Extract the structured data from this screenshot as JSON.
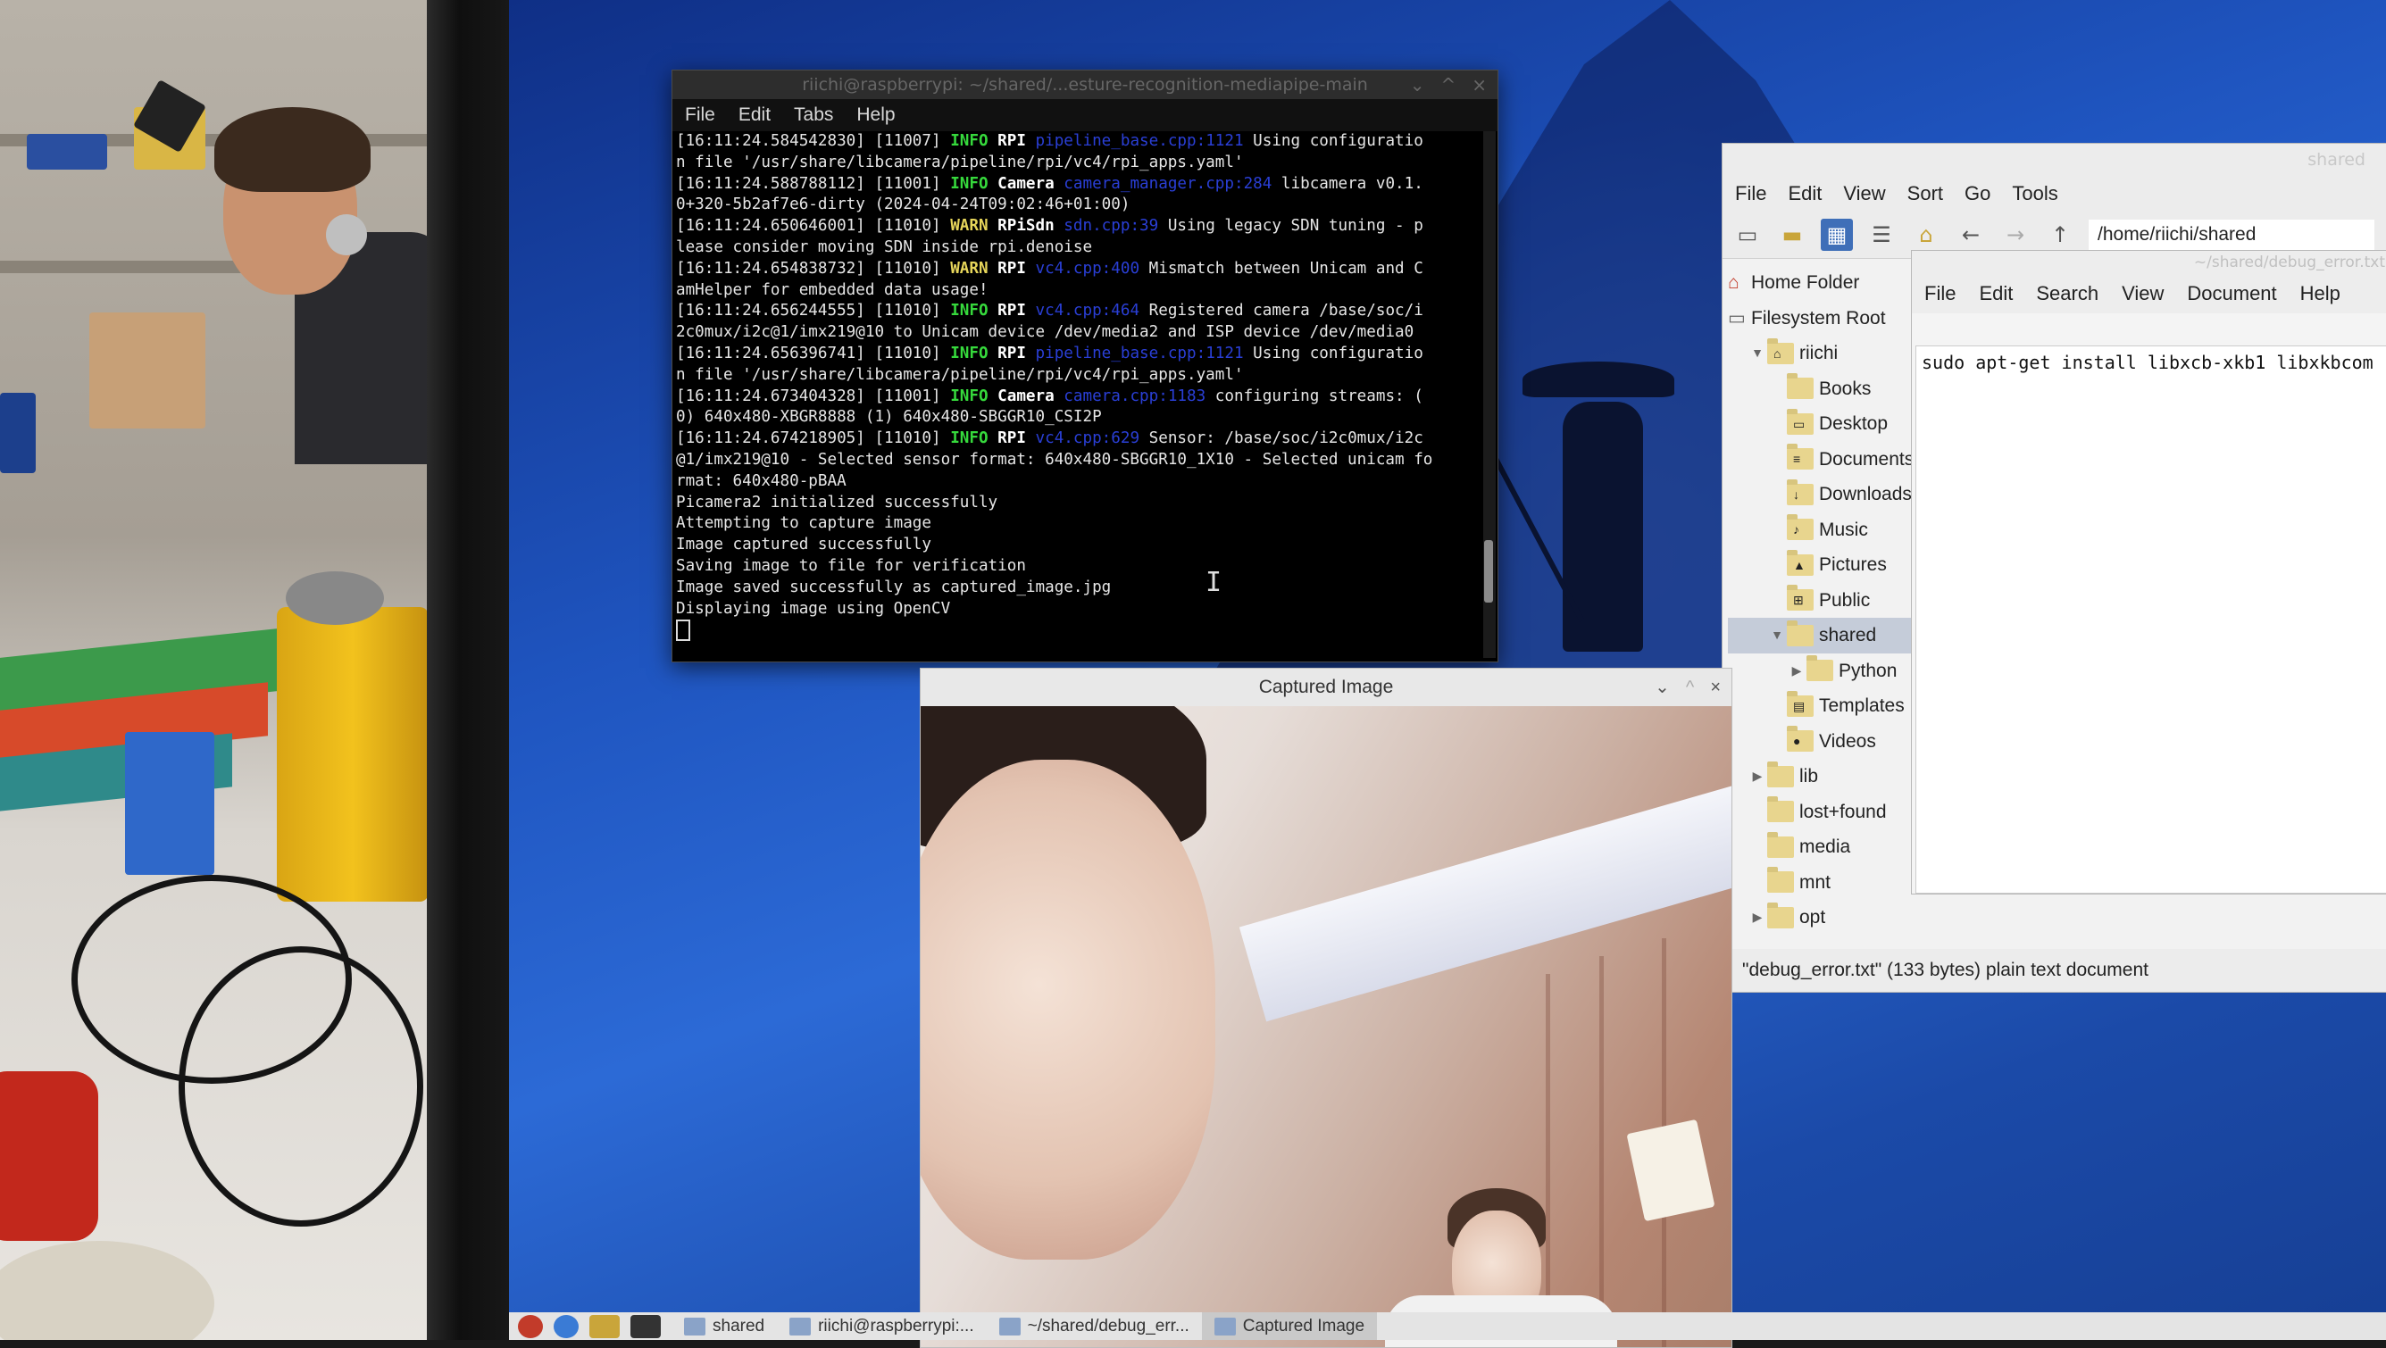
{
  "terminal": {
    "title": "riichi@raspberrypi: ~/shared/...esture-recognition-mediapipe-main",
    "menu": [
      "File",
      "Edit",
      "Tabs",
      "Help"
    ],
    "lines": [
      [
        {
          "t": "[16:11:24.584542830] [11007] "
        },
        {
          "t": "INFO",
          "c": "t-info"
        },
        {
          "t": " "
        },
        {
          "t": "RPI",
          "c": "t-cat"
        },
        {
          "t": " pipeline_base.cpp:1121",
          "c": "t-src"
        },
        {
          "t": " Using configuratio"
        }
      ],
      [
        {
          "t": "n file '/usr/share/libcamera/pipeline/rpi/vc4/rpi_apps.yaml'"
        }
      ],
      [
        {
          "t": "[16:11:24.588788112] [11001] "
        },
        {
          "t": "INFO",
          "c": "t-info"
        },
        {
          "t": " "
        },
        {
          "t": "Camera",
          "c": "t-cat"
        },
        {
          "t": " camera_manager.cpp:284",
          "c": "t-src"
        },
        {
          "t": " libcamera v0.1."
        }
      ],
      [
        {
          "t": "0+320-5b2af7e6-dirty (2024-04-24T09:02:46+01:00)"
        }
      ],
      [
        {
          "t": "[16:11:24.650646001] [11010] "
        },
        {
          "t": "WARN",
          "c": "t-warn"
        },
        {
          "t": " "
        },
        {
          "t": "RPiSdn",
          "c": "t-cat"
        },
        {
          "t": " sdn.cpp:39",
          "c": "t-src"
        },
        {
          "t": " Using legacy SDN tuning - p"
        }
      ],
      [
        {
          "t": "lease consider moving SDN inside rpi.denoise"
        }
      ],
      [
        {
          "t": "[16:11:24.654838732] [11010] "
        },
        {
          "t": "WARN",
          "c": "t-warn"
        },
        {
          "t": " "
        },
        {
          "t": "RPI",
          "c": "t-cat"
        },
        {
          "t": " vc4.cpp:400",
          "c": "t-src"
        },
        {
          "t": " Mismatch between Unicam and C"
        }
      ],
      [
        {
          "t": "amHelper for embedded data usage!"
        }
      ],
      [
        {
          "t": "[16:11:24.656244555] [11010] "
        },
        {
          "t": "INFO",
          "c": "t-info"
        },
        {
          "t": " "
        },
        {
          "t": "RPI",
          "c": "t-cat"
        },
        {
          "t": " vc4.cpp:464",
          "c": "t-src"
        },
        {
          "t": " Registered camera /base/soc/i"
        }
      ],
      [
        {
          "t": "2c0mux/i2c@1/imx219@10 to Unicam device /dev/media2 and ISP device /dev/media0"
        }
      ],
      [
        {
          "t": "[16:11:24.656396741] [11010] "
        },
        {
          "t": "INFO",
          "c": "t-info"
        },
        {
          "t": " "
        },
        {
          "t": "RPI",
          "c": "t-cat"
        },
        {
          "t": " pipeline_base.cpp:1121",
          "c": "t-src"
        },
        {
          "t": " Using configuratio"
        }
      ],
      [
        {
          "t": "n file '/usr/share/libcamera/pipeline/rpi/vc4/rpi_apps.yaml'"
        }
      ],
      [
        {
          "t": "[16:11:24.673404328] [11001] "
        },
        {
          "t": "INFO",
          "c": "t-info"
        },
        {
          "t": " "
        },
        {
          "t": "Camera",
          "c": "t-cat"
        },
        {
          "t": " camera.cpp:1183",
          "c": "t-src"
        },
        {
          "t": " configuring streams: ("
        }
      ],
      [
        {
          "t": "0) 640x480-XBGR8888 (1) 640x480-SBGGR10_CSI2P"
        }
      ],
      [
        {
          "t": "[16:11:24.674218905] [11010] "
        },
        {
          "t": "INFO",
          "c": "t-info"
        },
        {
          "t": " "
        },
        {
          "t": "RPI",
          "c": "t-cat"
        },
        {
          "t": " vc4.cpp:629",
          "c": "t-src"
        },
        {
          "t": " Sensor: /base/soc/i2c0mux/i2c"
        }
      ],
      [
        {
          "t": "@1/imx219@10 - Selected sensor format: 640x480-SBGGR10_1X10 - Selected unicam fo"
        }
      ],
      [
        {
          "t": "rmat: 640x480-pBAA"
        }
      ],
      [
        {
          "t": "Picamera2 initialized successfully"
        }
      ],
      [
        {
          "t": "Attempting to capture image"
        }
      ],
      [
        {
          "t": "Image captured successfully"
        }
      ],
      [
        {
          "t": "Saving image to file for verification"
        }
      ],
      [
        {
          "t": "Image saved successfully as captured_image.jpg"
        }
      ],
      [
        {
          "t": "Displaying image using OpenCV"
        }
      ]
    ],
    "scroll_position": 0.88
  },
  "captured_window": {
    "title": "Captured Image"
  },
  "file_manager": {
    "title": "shared",
    "menu": [
      "File",
      "Edit",
      "View",
      "Sort",
      "Go",
      "Tools"
    ],
    "path": "/home/riichi/shared",
    "places": [
      {
        "label": "Home Folder",
        "icon": "home-icon"
      },
      {
        "label": "Filesystem Root",
        "icon": "drive-icon"
      }
    ],
    "tree": [
      {
        "label": "riichi",
        "indent": 1,
        "toggle": "▼",
        "glyph": "⌂"
      },
      {
        "label": "Books",
        "indent": 2,
        "toggle": "",
        "glyph": ""
      },
      {
        "label": "Desktop",
        "indent": 2,
        "toggle": "",
        "glyph": "▭"
      },
      {
        "label": "Documents",
        "indent": 2,
        "toggle": "",
        "glyph": "≡"
      },
      {
        "label": "Downloads",
        "indent": 2,
        "toggle": "",
        "glyph": "↓"
      },
      {
        "label": "Music",
        "indent": 2,
        "toggle": "",
        "glyph": "♪"
      },
      {
        "label": "Pictures",
        "indent": 2,
        "toggle": "",
        "glyph": "▲"
      },
      {
        "label": "Public",
        "indent": 2,
        "toggle": "",
        "glyph": "⊞"
      },
      {
        "label": "shared",
        "indent": 2,
        "toggle": "▼",
        "glyph": "",
        "selected": true
      },
      {
        "label": "Python",
        "indent": 3,
        "toggle": "▶",
        "glyph": ""
      },
      {
        "label": "Templates",
        "indent": 2,
        "toggle": "",
        "glyph": "▤"
      },
      {
        "label": "Videos",
        "indent": 2,
        "toggle": "",
        "glyph": "●"
      },
      {
        "label": "lib",
        "indent": 1,
        "toggle": "▶",
        "glyph": ""
      },
      {
        "label": "lost+found",
        "indent": 1,
        "toggle": "",
        "glyph": ""
      },
      {
        "label": "media",
        "indent": 1,
        "toggle": "",
        "glyph": ""
      },
      {
        "label": "mnt",
        "indent": 1,
        "toggle": "",
        "glyph": ""
      },
      {
        "label": "opt",
        "indent": 1,
        "toggle": "▶",
        "glyph": ""
      }
    ],
    "status": "\"debug_error.txt\" (133 bytes) plain text document"
  },
  "editor": {
    "title": "~/shared/debug_error.txt",
    "menu": [
      "File",
      "Edit",
      "Search",
      "View",
      "Document",
      "Help"
    ],
    "content": "sudo apt-get install libxcb-xkb1 libxkbcom"
  },
  "taskbar": {
    "items": [
      {
        "label": "shared",
        "active": false
      },
      {
        "label": "riichi@raspberrypi:...",
        "active": false
      },
      {
        "label": "~/shared/debug_err...",
        "active": false
      },
      {
        "label": "Captured Image",
        "active": true
      }
    ]
  },
  "colors": {
    "desktop_blue": "#1f55c0",
    "info_green": "#36d93c",
    "warn_yellow": "#e6d55a",
    "selection": "#c5ccd9"
  }
}
